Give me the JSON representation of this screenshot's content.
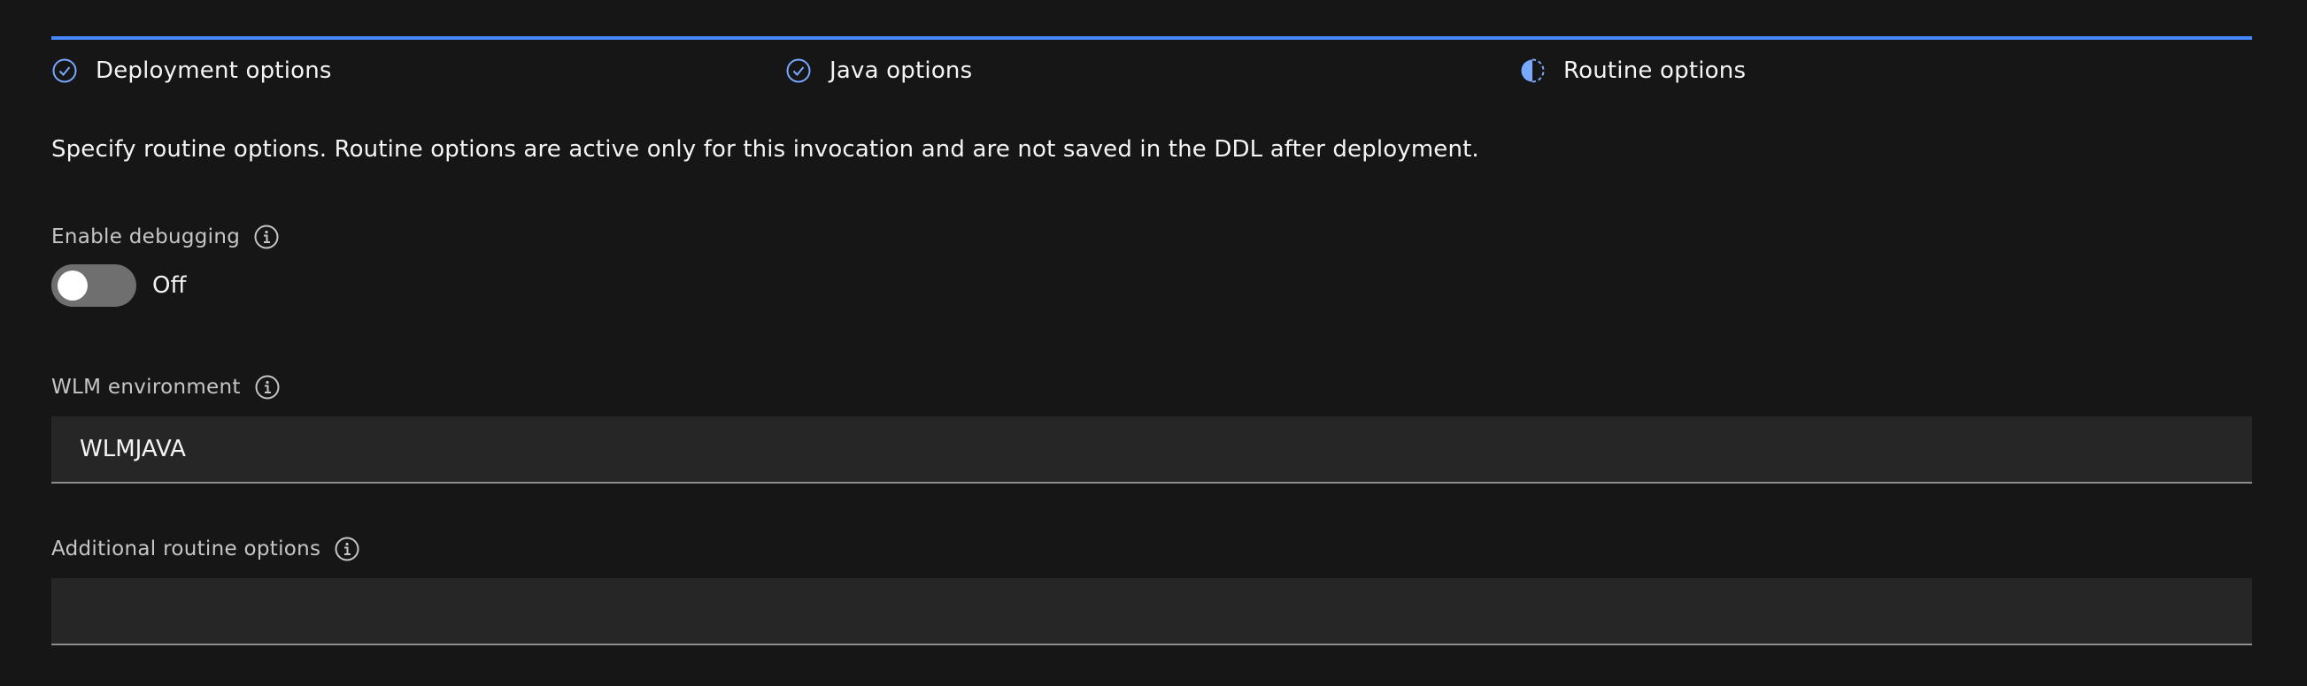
{
  "progress": {
    "steps": [
      {
        "label": "Deployment options",
        "status": "complete",
        "icon": "checkmark-outline-icon"
      },
      {
        "label": "Java options",
        "status": "complete",
        "icon": "checkmark-outline-icon"
      },
      {
        "label": "Routine options",
        "status": "current",
        "icon": "incomplete-icon"
      }
    ],
    "accent_color": "#4589ff"
  },
  "description": "Specify routine options. Routine options are active only for this invocation and are not saved in the DDL after deployment.",
  "fields": {
    "enable_debugging": {
      "label": "Enable debugging",
      "info_icon": "information-icon",
      "toggle_state": "Off"
    },
    "wlm_environment": {
      "label": "WLM environment",
      "info_icon": "information-icon",
      "value": "WLMJAVA"
    },
    "additional_routine_options": {
      "label": "Additional routine options",
      "info_icon": "information-icon",
      "value": ""
    }
  }
}
